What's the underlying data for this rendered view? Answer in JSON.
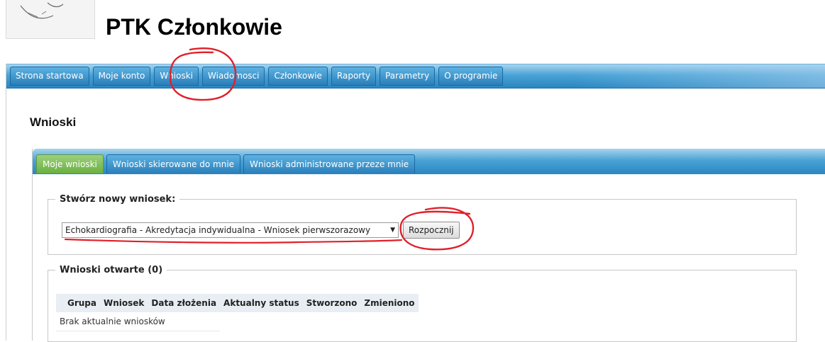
{
  "app": {
    "title": "PTK Członkowie"
  },
  "main_nav": {
    "tabs": [
      {
        "label": "Strona startowa"
      },
      {
        "label": "Moje konto"
      },
      {
        "label": "Wnioski"
      },
      {
        "label": "Wiadomosci"
      },
      {
        "label": "Członkowie"
      },
      {
        "label": "Raporty"
      },
      {
        "label": "Parametry"
      },
      {
        "label": "O programie"
      }
    ]
  },
  "page": {
    "title": "Wnioski"
  },
  "sub_nav": {
    "tabs": [
      {
        "label": "Moje wnioski",
        "active": true
      },
      {
        "label": "Wnioski skierowane do mnie"
      },
      {
        "label": "Wnioski administrowane przeze mnie"
      }
    ]
  },
  "create_section": {
    "legend": "Stwórz nowy wniosek:",
    "selected_option": "Echokardiografia - Akredytacja indywidualna - Wniosek pierwszorazowy",
    "start_button": "Rozpocznij"
  },
  "open_section": {
    "legend": "Wnioski otwarte (0)",
    "columns": [
      "Grupa",
      "Wniosek",
      "Data złożenia",
      "Aktualny status",
      "Stworzono",
      "Zmieniono"
    ],
    "empty_message": "Brak aktualnie wniosków"
  },
  "colors": {
    "tab_blue": "#3d95cf",
    "tab_active_green": "#6ab043",
    "annotation_red": "#e0202a"
  },
  "icons": [
    "logo-seal-icon",
    "dropdown-arrow-icon"
  ]
}
